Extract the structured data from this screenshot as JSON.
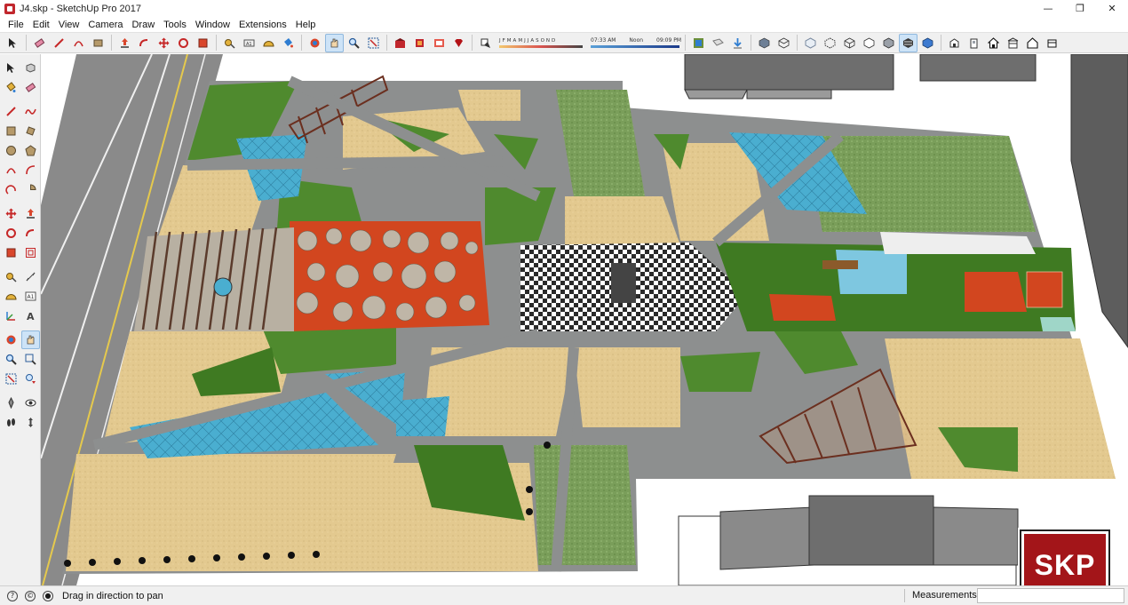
{
  "window": {
    "title": "J4.skp - SketchUp Pro 2017",
    "minimize": "—",
    "maximize": "❐",
    "close": "✕"
  },
  "menu": [
    "File",
    "Edit",
    "View",
    "Camera",
    "Draw",
    "Tools",
    "Window",
    "Extensions",
    "Help"
  ],
  "shadow_settings": {
    "months": [
      "J",
      "F",
      "M",
      "A",
      "M",
      "J",
      "J",
      "A",
      "S",
      "O",
      "N",
      "D"
    ],
    "time_start": "07:33 AM",
    "time_mid": "Noon",
    "time_end": "09:09 PM"
  },
  "status": {
    "hint": "Drag in direction to pan",
    "measurements_label": "Measurements",
    "measurements_value": ""
  },
  "watermark": {
    "text": "SKP"
  },
  "colors": {
    "asphalt": "#8a8a8a",
    "sand": "#e3c98f",
    "grass": "#4f8a2e",
    "water": "#4aaed0",
    "accent_orange": "#d2461f",
    "brand_red": "#a31519"
  },
  "icons": {
    "toolbar_top": [
      "select-icon",
      "eraser-icon",
      "line-icon",
      "rectangle-icon",
      "paint-bucket-icon",
      "push-pull-icon",
      "follow-me-icon",
      "move-icon",
      "rotate-icon",
      "scale-icon",
      "tape-measure-icon",
      "dimension-icon",
      "protractor-icon",
      "orbit-icon",
      "pan-icon",
      "zoom-icon",
      "zoom-extents-icon",
      "warehouse-icon",
      "extension-warehouse-icon",
      "layout-icon",
      "ruby-icon",
      "shadow-icon",
      "section-plane-icon",
      "section-fill-icon",
      "iso-view-icon",
      "top-view-icon",
      "front-view-icon",
      "right-view-icon",
      "back-view-icon",
      "left-view-icon",
      "xray-icon",
      "back-edges-icon",
      "wireframe-icon",
      "hidden-line-icon",
      "shaded-icon",
      "textured-icon",
      "monochrome-icon",
      "house-icon"
    ]
  }
}
